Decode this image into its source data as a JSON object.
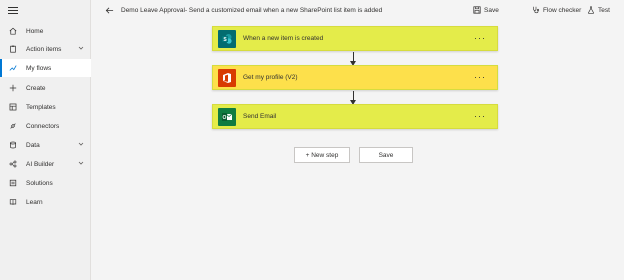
{
  "header": {
    "title": "Demo Leave Approval- Send a customized email when a new SharePoint list item is added",
    "save_label": "Save",
    "flow_checker_label": "Flow checker",
    "test_label": "Test"
  },
  "sidebar": {
    "items": [
      {
        "label": "Home",
        "icon": "home-icon"
      },
      {
        "label": "Action items",
        "icon": "clipboard-icon"
      },
      {
        "label": "My flows",
        "icon": "flow-icon"
      },
      {
        "label": "Create",
        "icon": "plus-icon"
      },
      {
        "label": "Templates",
        "icon": "templates-icon"
      },
      {
        "label": "Connectors",
        "icon": "connector-icon"
      },
      {
        "label": "Data",
        "icon": "database-icon"
      },
      {
        "label": "AI Builder",
        "icon": "ai-builder-icon"
      },
      {
        "label": "Solutions",
        "icon": "solutions-icon"
      },
      {
        "label": "Learn",
        "icon": "book-icon"
      }
    ],
    "active": "My flows"
  },
  "steps": [
    {
      "label": "When a new item is created",
      "icon": "sharepoint-icon",
      "more": "···"
    },
    {
      "label": "Get my profile (V2)",
      "icon": "office365-icon",
      "more": "···"
    },
    {
      "label": "Send Email",
      "icon": "outlook-icon",
      "more": "···"
    }
  ],
  "actions": {
    "new_step_label": "+ New step",
    "save_label": "Save"
  },
  "colors": {
    "highlight_yellow": "#e4ec4a",
    "highlight_orange": "#fde04b",
    "sharepoint": "#036c70",
    "office365": "#d83b01",
    "outlook_mail": "#107c41",
    "accent": "#0078d4"
  }
}
